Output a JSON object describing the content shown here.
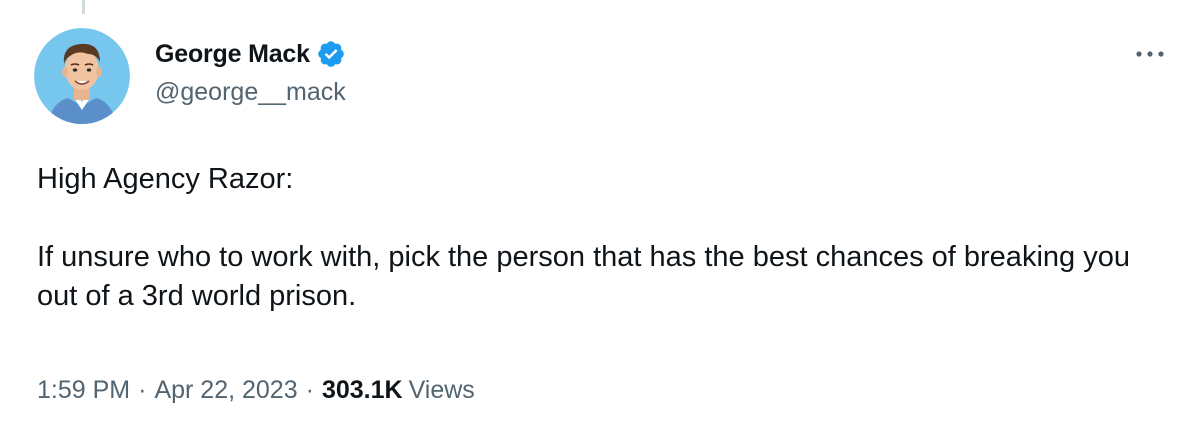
{
  "tweet": {
    "author": {
      "name": "George Mack",
      "handle": "@george__mack",
      "verified": true
    },
    "text_line_1": "High Agency Razor:",
    "text_line_2": "If unsure who to work with, pick the person that has the best chances of breaking you out of a 3rd world prison.",
    "time": "1:59 PM",
    "date": "Apr 22, 2023",
    "separator": "·",
    "views_count": "303.1K",
    "views_label": "Views"
  },
  "colors": {
    "verified_blue": "#1d9bf0",
    "secondary_text": "#536471",
    "primary_text": "#0f1419",
    "avatar_background": "#76c6ee"
  },
  "icons": {
    "verified": "verified-badge-icon",
    "more": "more-options-icon"
  }
}
